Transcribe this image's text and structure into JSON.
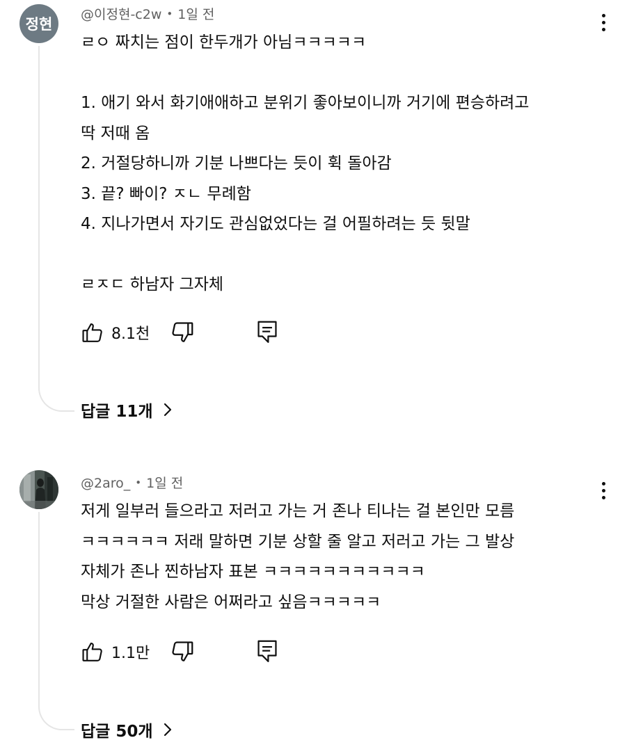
{
  "comments": [
    {
      "avatar_text": "정현",
      "author": "@이정현-c2w",
      "time": "1일 전",
      "lines": [
        "ㄹㅇ 짜치는 점이 한두개가 아님ㅋㅋㅋㅋㅋ",
        "",
        "1. 애기 와서 화기애애하고 분위기 좋아보이니까 거기에 편승하려고",
        "딱 저때 옴",
        "2. 거절당하니까 기분 나쁘다는 듯이 휙 돌아감",
        "3. 끝? 빠이? ㅈㄴ 무례함",
        "4. 지나가면서 자기도 관심없었다는 걸 어필하려는 듯 뒷말",
        "",
        "ㄹㅈㄷ 하남자 그자체"
      ],
      "likes": "8.1천",
      "replies_label": "답글 11개",
      "icons": [
        "thumbs-up-icon",
        "thumbs-down-icon",
        "reply-icon",
        "more-vert-icon",
        "chevron-right-icon"
      ]
    },
    {
      "avatar_text": "",
      "author": "@2aro_",
      "time": "1일 전",
      "lines": [
        "저게 일부러 들으라고 저러고 가는 거 존나 티나는 걸 본인만 모름",
        "ㅋㅋㅋㅋㅋㅋ 저래 말하면 기분 상할 줄 알고 저러고 가는 그 발상",
        "자체가 존나 찐하남자 표본 ㅋㅋㅋㅋㅋㅋㅋㅋㅋㅋㅋ",
        "막상 거절한 사람은 어쩌라고 싶음ㅋㅋㅋㅋㅋ"
      ],
      "likes": "1.1만",
      "replies_label": "답글 50개",
      "icons": [
        "thumbs-up-icon",
        "thumbs-down-icon",
        "reply-icon",
        "more-vert-icon",
        "chevron-right-icon"
      ]
    }
  ],
  "colors": {
    "avatar_bg": "#6d7a83",
    "meta_text": "#606060",
    "thread_line": "#e5e5e5",
    "text": "#0f0f0f"
  }
}
